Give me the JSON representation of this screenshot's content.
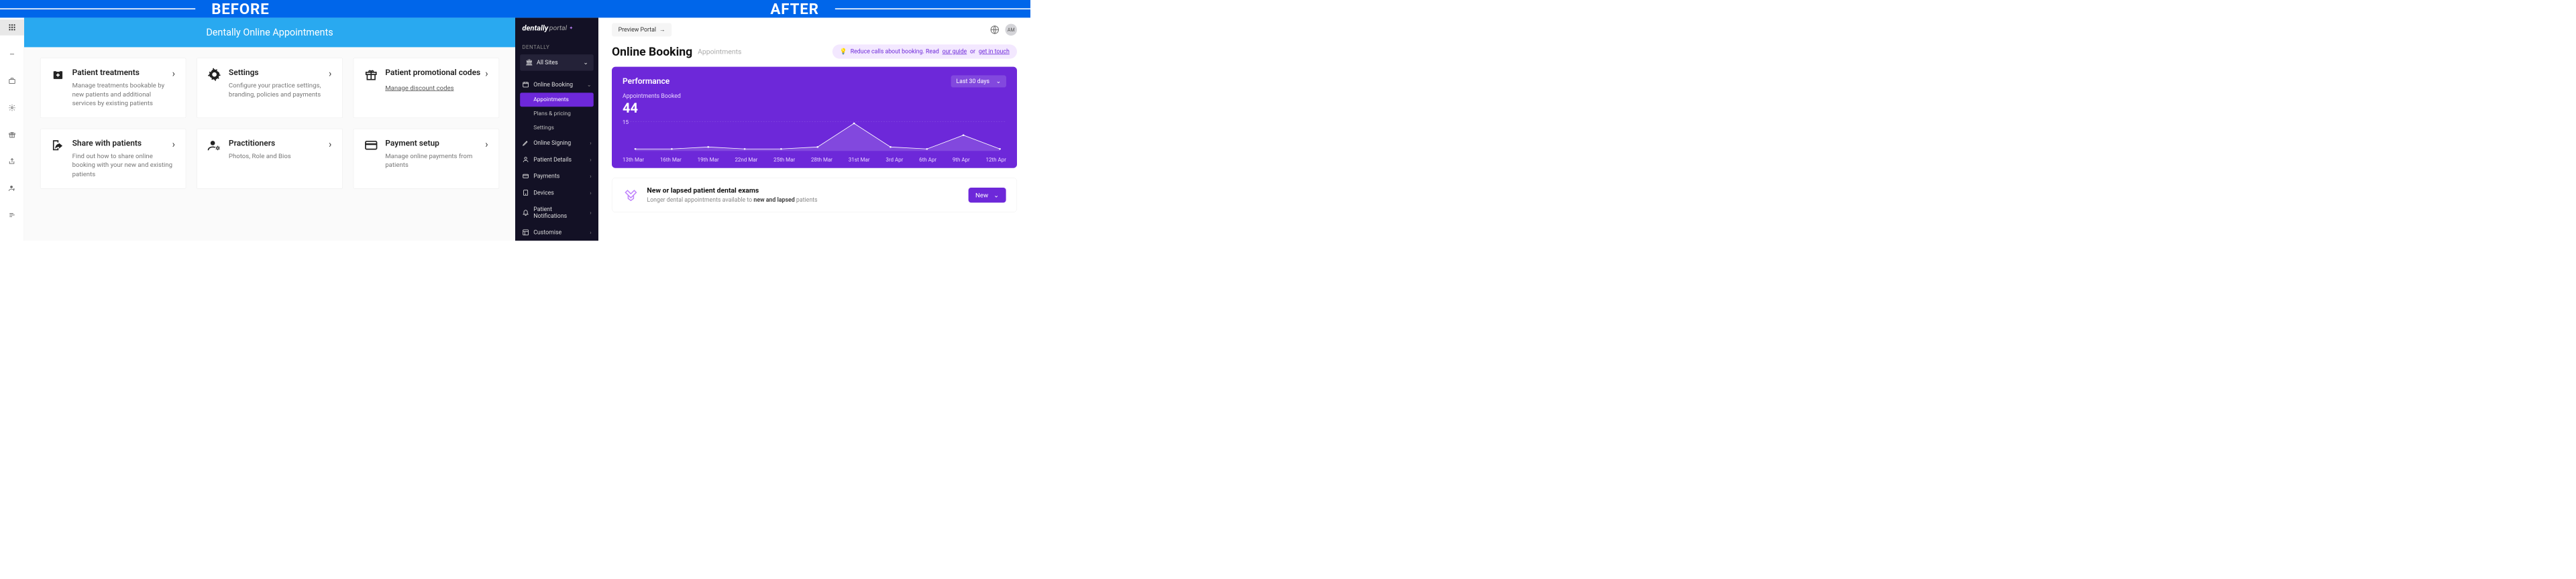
{
  "banner": {
    "before": "BEFORE",
    "after": "AFTER"
  },
  "before": {
    "title": "Dentally Online Appointments",
    "cards": [
      {
        "title": "Patient treatments",
        "desc": "Manage treatments bookable by new patients and additional services by existing patients"
      },
      {
        "title": "Settings",
        "desc": "Configure your practice settings, branding, policies and payments"
      },
      {
        "title": "Patient promotional codes",
        "desc": "",
        "link": "Manage discount codes"
      },
      {
        "title": "Share with patients",
        "desc": "Find out how to share online booking with your new and existing patients"
      },
      {
        "title": "Practitioners",
        "desc": "Photos, Role and Bios"
      },
      {
        "title": "Payment setup",
        "desc": "Manage online payments from patients"
      }
    ]
  },
  "after": {
    "brand1": "dentally",
    "brand2": "portal",
    "section_label": "DENTALLY",
    "site_selector": "All Sites",
    "nav": [
      {
        "label": "Online Booking",
        "expanded": true
      },
      {
        "label": "Online Signing"
      },
      {
        "label": "Patient Details"
      },
      {
        "label": "Payments"
      },
      {
        "label": "Devices"
      },
      {
        "label": "Patient Notifications"
      },
      {
        "label": "Customise"
      }
    ],
    "subnav": [
      {
        "label": "Appointments",
        "active": true
      },
      {
        "label": "Plans & pricing"
      },
      {
        "label": "Settings"
      }
    ],
    "preview": "Preview Portal",
    "avatar": "AM",
    "page_title": "Online Booking",
    "page_sub": "Appointments",
    "tip_prefix": "Reduce calls about booking. Read ",
    "tip_link1": "our guide",
    "tip_mid": " or ",
    "tip_link2": "get in touch",
    "perf_title": "Performance",
    "period": "Last 30 days",
    "metric_label": "Appointments Booked",
    "metric_value": "44",
    "ytick": "15",
    "xticks": [
      "13th Mar",
      "16th Mar",
      "19th Mar",
      "22nd Mar",
      "25th Mar",
      "28th Mar",
      "31st Mar",
      "3rd Apr",
      "6th Apr",
      "9th Apr",
      "12th Apr"
    ],
    "info_title": "New or lapsed patient dental exams",
    "info_desc_a": "Longer dental appointments available to ",
    "info_desc_b": "new and lapsed",
    "info_desc_c": " patients",
    "new_btn": "New"
  },
  "chart_data": {
    "type": "line",
    "title": "Appointments Booked",
    "categories": [
      "13th Mar",
      "16th Mar",
      "19th Mar",
      "22nd Mar",
      "25th Mar",
      "28th Mar",
      "31st Mar",
      "3rd Apr",
      "6th Apr",
      "9th Apr",
      "12th Apr"
    ],
    "values": [
      1,
      1,
      2,
      1,
      1,
      2,
      14,
      2,
      1,
      8,
      1
    ],
    "ylim": [
      0,
      15
    ],
    "xlabel": "",
    "ylabel": ""
  }
}
